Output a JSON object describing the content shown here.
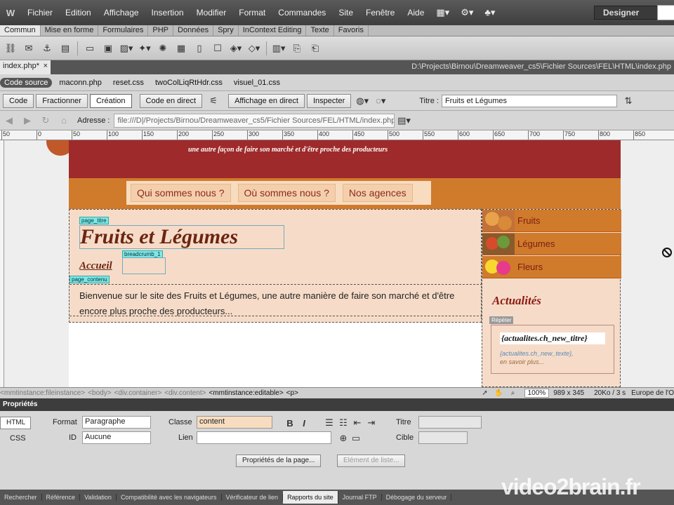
{
  "app": {
    "logo": "W",
    "designer": "Designer"
  },
  "menu": [
    "Fichier",
    "Edition",
    "Affichage",
    "Insertion",
    "Modifier",
    "Format",
    "Commandes",
    "Site",
    "Fenêtre",
    "Aide"
  ],
  "insert_tabs": [
    "Commun",
    "Mise en forme",
    "Formulaires",
    "PHP",
    "Données",
    "Spry",
    "InContext Editing",
    "Texte",
    "Favoris"
  ],
  "doc": {
    "tab": "index.php*",
    "close": "×",
    "path": "D:\\Projects\\Birnou\\Dreamweaver_cs5\\Fichier Sources\\FEL\\HTML\\index.php"
  },
  "related": [
    "Code source",
    "maconn.php",
    "reset.css",
    "twoColLiqRtHdr.css",
    "visuel_01.css"
  ],
  "docbar": {
    "code": "Code",
    "split": "Fractionner",
    "design": "Création",
    "live_code": "Code en direct",
    "live_view": "Affichage en direct",
    "inspect": "Inspecter",
    "title_label": "Titre :",
    "title_value": "Fruits et Légumes"
  },
  "address": {
    "label": "Adresse :",
    "value": "file:///D|/Projects/Birnou/Dreamweaver_cs5/Fichier Sources/FEL/HTML/index.php"
  },
  "ruler": [
    "50",
    "0",
    "50",
    "100",
    "150",
    "200",
    "250",
    "300",
    "350",
    "400",
    "450",
    "500",
    "550",
    "600",
    "650",
    "700",
    "750",
    "800",
    "850"
  ],
  "page": {
    "tagline": "une autre façon de faire son marché et d'être proche des producteurs",
    "nav": [
      "Qui sommes nous ?",
      "Où sommes nous ?",
      "Nos agences"
    ],
    "tag_title": "page_titre",
    "title": "Fruits et Légumes",
    "tag_breadcrumb": "breadcrumb_1",
    "breadcrumb": "Accueil",
    "tag_content": "page_contenu",
    "content": "Bienvenue sur le site des Fruits et Légumes, une autre manière de faire son marché et d'être encore plus proche des producteurs...",
    "side": [
      "Fruits",
      "Légumes",
      "Fleurs"
    ],
    "news_heading": "Actualités",
    "repeat": "Répéter",
    "news_title": "{actualites.ch_new_titre}",
    "news_text": "{actualites.ch_new_texte},",
    "news_more": "en savoir plus..."
  },
  "status": {
    "crumbs": [
      "<mmtinstance:fileinstance>",
      "<body>",
      "<div.container>",
      "<div.content>",
      "<mmtinstance:editable>",
      "<p>"
    ],
    "zoom": "100%",
    "size": "989 x 345",
    "weight": "20Ko / 3 s",
    "encoding": "Europe de l'O"
  },
  "props": {
    "header": "Propriétés",
    "html": "HTML",
    "css": "CSS",
    "format_label": "Format",
    "format": "Paragraphe",
    "id_label": "ID",
    "id": "Aucune",
    "class_label": "Classe",
    "class": "content",
    "link_label": "Lien",
    "title_label": "Titre",
    "target_label": "Cible",
    "page_props": "Propriétés de la page...",
    "list_item": "Elément de liste..."
  },
  "bottom_tabs": [
    "Rechercher",
    "Référence",
    "Validation",
    "Compatibilité avec les navigateurs",
    "Vérificateur de lien",
    "Rapports du site",
    "Journal FTP",
    "Débogage du serveur"
  ],
  "watermark": "video2brain.fr"
}
